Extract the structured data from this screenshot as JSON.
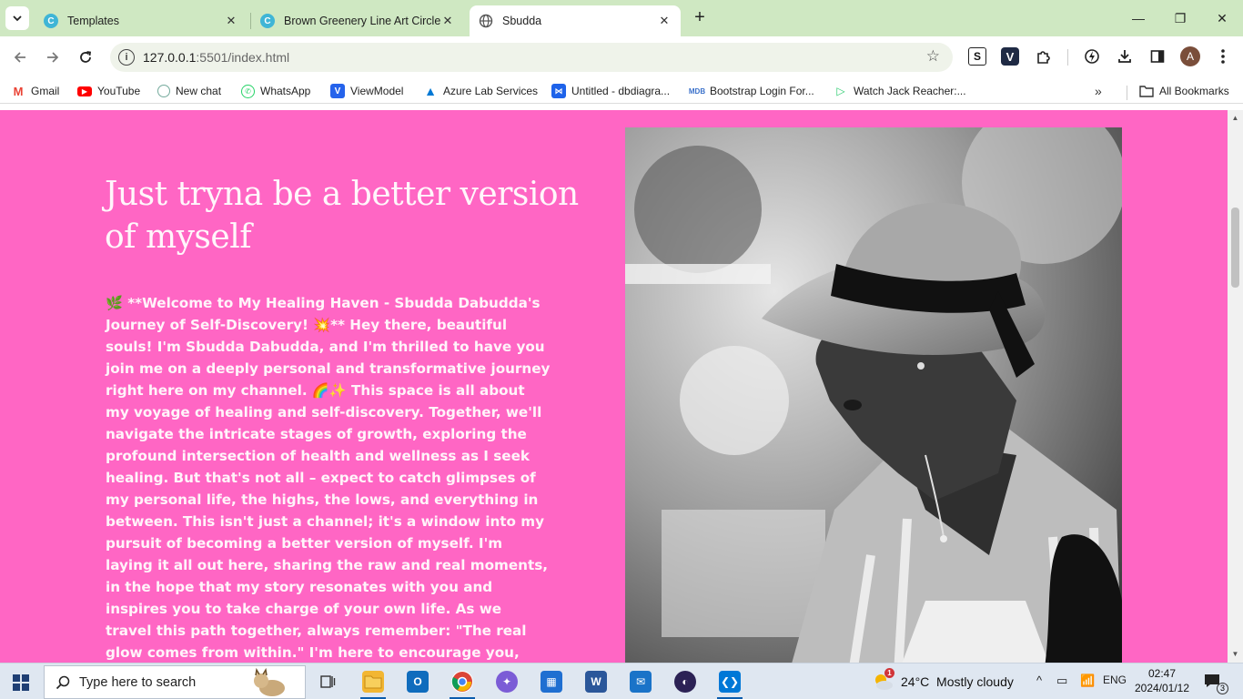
{
  "browser": {
    "tabs": [
      {
        "title": "Templates",
        "close": "✕"
      },
      {
        "title": "Brown Greenery Line Art Circle I",
        "close": "✕"
      },
      {
        "title": "Sbudda",
        "close": "✕"
      }
    ],
    "new_tab": "+",
    "window_controls": {
      "minimize": "—",
      "maximize": "❐",
      "close": "✕"
    },
    "address": {
      "host": "127.0.0.1",
      "path": ":5501/index.html"
    },
    "avatar_letter": "A",
    "extensions": [
      {
        "label": "S"
      },
      {
        "label": "V"
      }
    ]
  },
  "bookmarks": [
    {
      "label": "Gmail",
      "icon": "gmail-icon",
      "color": "#ea4335"
    },
    {
      "label": "YouTube",
      "icon": "youtube-icon",
      "color": "#ff0000"
    },
    {
      "label": "New chat",
      "icon": "chatgpt-icon",
      "color": "#74aa9c"
    },
    {
      "label": "WhatsApp",
      "icon": "whatsapp-icon",
      "color": "#25d366"
    },
    {
      "label": "ViewModel",
      "icon": "viewmodel-icon",
      "color": "#2563eb"
    },
    {
      "label": "Azure Lab Services",
      "icon": "azure-icon",
      "color": "#0078d4"
    },
    {
      "label": "Untitled - dbdiagra...",
      "icon": "dbdiagram-icon",
      "color": "#1e63ea"
    },
    {
      "label": "Bootstrap Login For...",
      "icon": "mdb-icon",
      "color": "#3b71ca"
    },
    {
      "label": "Watch Jack Reacher:...",
      "icon": "play-icon",
      "color": "#2ecc71"
    }
  ],
  "bookmarks_more": "»",
  "all_bookmarks": "All Bookmarks",
  "page": {
    "background": "#ff66c4",
    "headline": "Just tryna be a better version of myself",
    "body": "🌿 **Welcome to My Healing Haven - Sbudda Dabudda's Journey of Self-Discovery! 💥** Hey there, beautiful souls! I'm Sbudda Dabudda, and I'm thrilled to have you join me on a deeply personal and transformative journey right here on my channel. 🌈✨ This space is all about my voyage of healing and self-discovery. Together, we'll navigate the intricate stages of growth, exploring the profound intersection of health and wellness as I seek healing. But that's not all – expect to catch glimpses of my personal life, the highs, the lows, and everything in between. This isn't just a channel; it's a window into my pursuit of becoming a better version of myself. I'm laying it all out here, sharing the raw and real moments, in the hope that my story resonates with you and inspires you to take charge of your own life. As we travel this path together, always remember: \"The real glow comes from within.\" I'm here to encourage you, uplift you, and remind you that your journey is uniquely yours, and it's beautiful. If you're ready for"
  },
  "taskbar": {
    "search_placeholder": "Type here to search",
    "weather_badge": "1",
    "weather": "24°C  Mostly cloudy",
    "language": "ENG",
    "time": "02:47",
    "date": "2024/01/12",
    "notification_count": "3",
    "apps": [
      {
        "icon": "task-view-icon",
        "color": "#444444"
      },
      {
        "icon": "file-explorer-icon",
        "color": "#f2b632"
      },
      {
        "icon": "outlook-icon",
        "color": "#0f6cbd"
      },
      {
        "icon": "chrome-icon",
        "color": "#db4437"
      },
      {
        "icon": "copilot-icon",
        "color": "#7b5cd6"
      },
      {
        "icon": "store-icon",
        "color": "#1f6fd1"
      },
      {
        "icon": "word-icon",
        "color": "#2b579a"
      },
      {
        "icon": "mail-icon",
        "color": "#1a73c8"
      },
      {
        "icon": "eclipse-icon",
        "color": "#2c2255"
      },
      {
        "icon": "vscode-icon",
        "color": "#0078d7"
      }
    ]
  }
}
